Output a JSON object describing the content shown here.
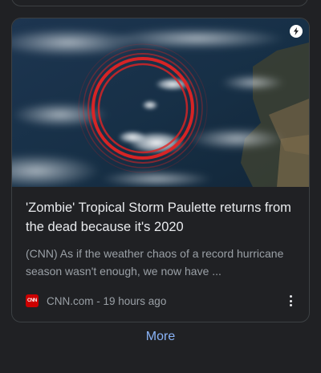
{
  "article": {
    "title": "'Zombie' Tropical Storm Paulette returns from the dead because it's 2020",
    "snippet": "(CNN) As if the weather chaos of a record hurricane season wasn't enough, we now have ...",
    "source_logo_text": "CNN",
    "source_name": "CNN.com",
    "separator": " - ",
    "time_ago": "19 hours ago",
    "amp_icon": "lightning-bolt-icon",
    "menu_icon": "more-vert-icon"
  },
  "footer": {
    "more_label": "More"
  },
  "colors": {
    "background": "#202124",
    "card_border": "#3c4043",
    "title": "#e8eaed",
    "snippet": "#9aa0a6",
    "link": "#8ab4f8",
    "cnn_red": "#cc0000"
  }
}
